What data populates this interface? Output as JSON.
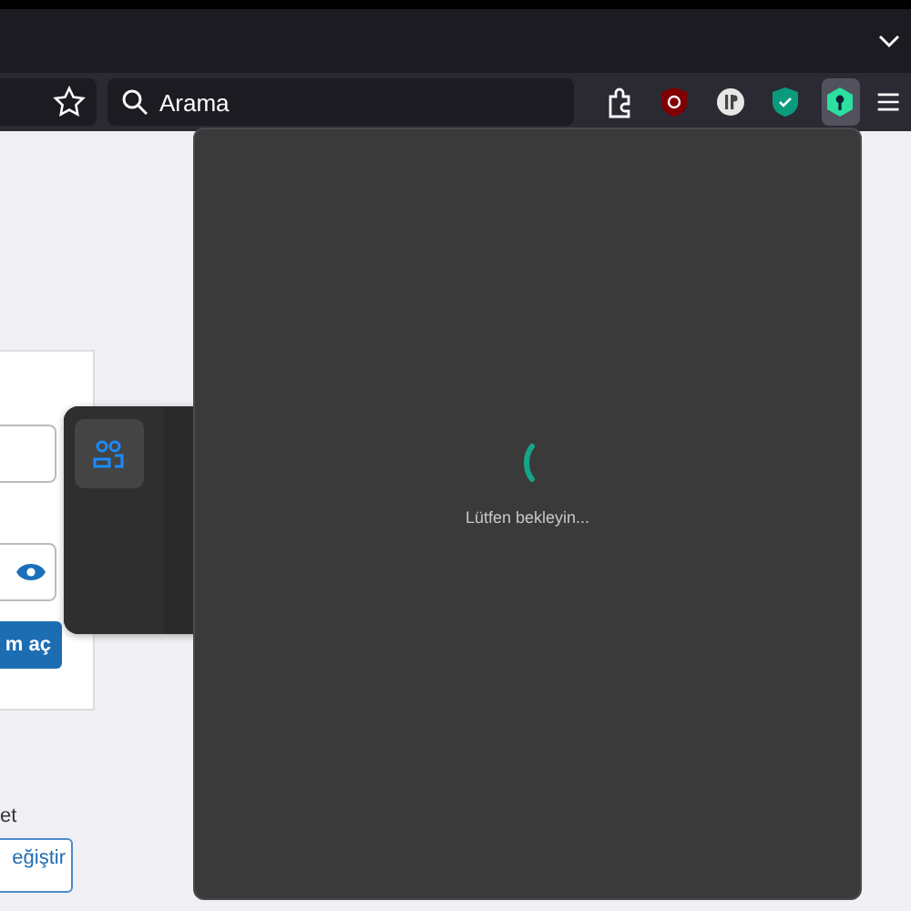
{
  "toolbar": {
    "search": {
      "placeholder": "Arama"
    },
    "extensions": [
      {
        "kind": "puzzle",
        "selected": false
      },
      {
        "kind": "shield-red",
        "selected": false
      },
      {
        "kind": "ip",
        "selected": false
      },
      {
        "kind": "shield-green",
        "selected": false
      },
      {
        "kind": "hexagon",
        "selected": true
      }
    ]
  },
  "page": {
    "login_button": "m aç",
    "note": "et",
    "change_button": "eğiştir"
  },
  "side_panel": {
    "items": [
      {
        "kind": "people",
        "selected": true
      }
    ]
  },
  "popup": {
    "status": "Lütfen bekleyin..."
  }
}
